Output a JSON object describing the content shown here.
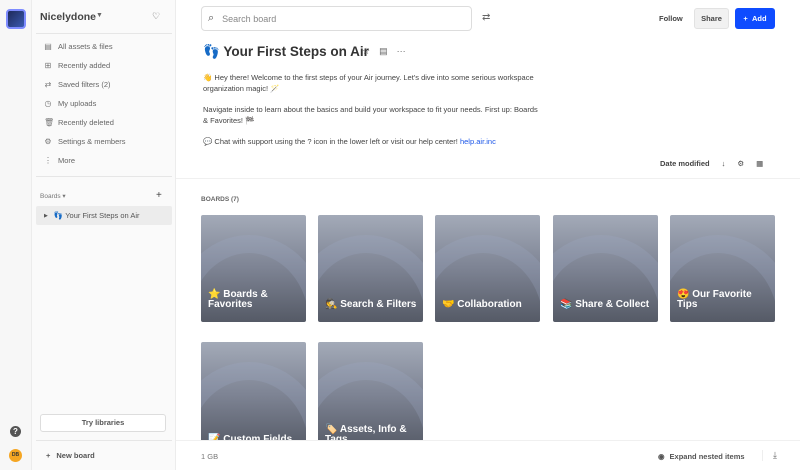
{
  "workspace": {
    "name": "Nicelydone",
    "avatar_initials": "DB"
  },
  "sidebar": {
    "items": [
      {
        "label": "All assets & files",
        "icon": "files-icon"
      },
      {
        "label": "Recently added",
        "icon": "plus-square-icon"
      },
      {
        "label": "Saved filters (2)",
        "icon": "filters-icon"
      },
      {
        "label": "My uploads",
        "icon": "clock-icon"
      },
      {
        "label": "Recently deleted",
        "icon": "trash-icon"
      },
      {
        "label": "Settings & members",
        "icon": "gear-icon"
      },
      {
        "label": "More",
        "icon": "more-icon"
      }
    ],
    "boards_header": "Boards",
    "board_item": "Your First Steps on Air",
    "board_emoji": "👣",
    "try_libraries": "Try libraries",
    "new_board": "New board"
  },
  "header": {
    "search_placeholder": "Search board",
    "follow": "Follow",
    "share": "Share",
    "add": "Add"
  },
  "board": {
    "emoji": "👣",
    "title": "Your First Steps on Air",
    "desc1": "👋 Hey there! Welcome to the first steps of your Air journey. Let's dive into some serious workspace organization magic! 🪄",
    "desc2": "Navigate inside to learn about the basics and build your workspace to fit your needs. First up: Boards & Favorites! 🏁",
    "desc3": "💬 Chat with support using the ? icon in the lower left or visit our help center! ",
    "help_link": "help.air.inc",
    "sort_label": "Date modified",
    "boards_count": "BOARDS (7)",
    "cards": [
      "⭐ Boards & Favorites",
      "🕵️ Search & Filters",
      "🤝 Collaboration",
      "📚 Share & Collect",
      "😍 Our Favorite Tips",
      "📝 Custom Fields",
      "🏷️ Assets, Info & Tags"
    ]
  },
  "footer": {
    "storage": "1 GB",
    "expand": "Expand nested items"
  },
  "colors": {
    "accent": "#0f4cff"
  }
}
